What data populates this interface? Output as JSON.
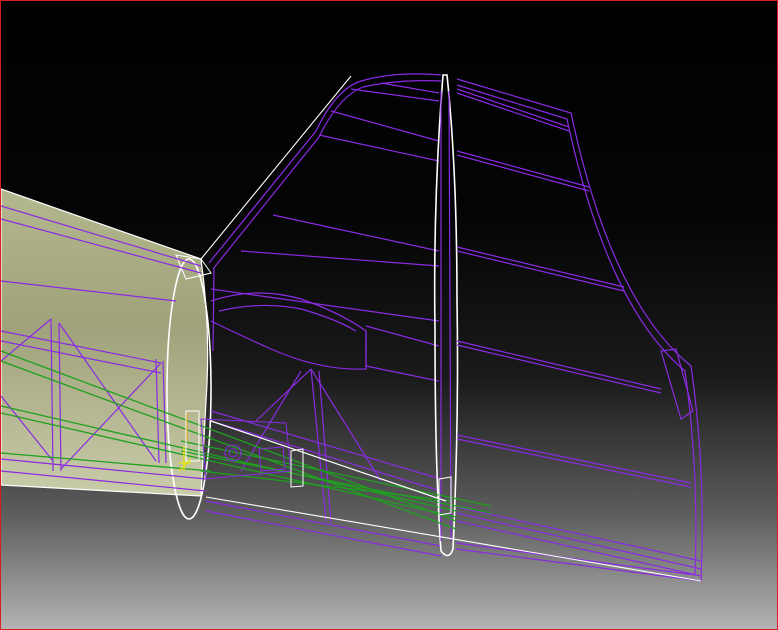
{
  "viewport": {
    "frame_color": "#d81e1e",
    "background_top": "#000000",
    "background_bottom": "#b3b3b3"
  },
  "model": {
    "fuselage_fill": "#a8ac82",
    "structure_color": "#8a2be2",
    "harness_color": "#1fa01f",
    "highlight_color": "#ffffff",
    "marker_color": "#e8e800"
  }
}
